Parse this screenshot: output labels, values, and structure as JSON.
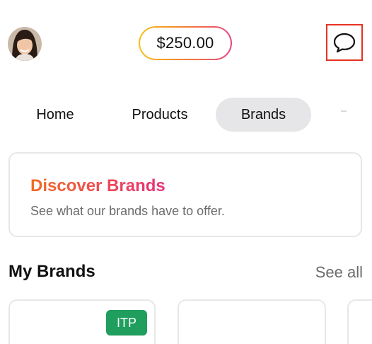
{
  "header": {
    "balance": "$250.00",
    "avatar_icon": "user-avatar",
    "chat_icon": "chat-bubble-icon"
  },
  "tabs": [
    {
      "label": "Home"
    },
    {
      "label": "Products"
    },
    {
      "label": "Brands",
      "selected": true
    }
  ],
  "discover": {
    "title": "Discover Brands",
    "subtitle": "See what our brands have to offer."
  },
  "my_brands": {
    "title": "My Brands",
    "see_all": "See all",
    "cards": [
      {
        "badge": "ITP"
      },
      {},
      {}
    ]
  },
  "colors": {
    "accent_gradient": [
      "#f16a24",
      "#e2327b"
    ],
    "badge_green": "#1f9e5e",
    "selected_tab_bg": "#e6e6e8",
    "highlight_border": "#e53323"
  }
}
